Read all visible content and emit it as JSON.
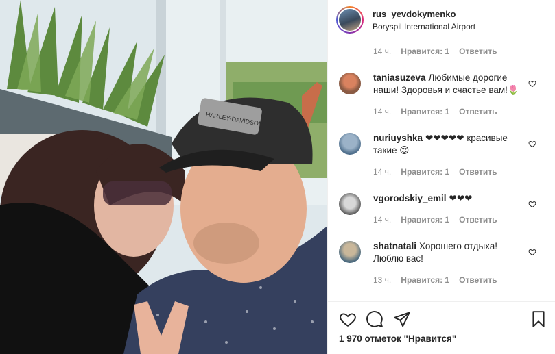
{
  "post": {
    "username": "rus_yevdokymenko",
    "location": "Boryspil International Airport",
    "photo_cap_text": "HARLEY-DAVIDSON"
  },
  "first_meta": {
    "time": "14 ч.",
    "likes": "Нравится: 1",
    "reply": "Ответить"
  },
  "comments": [
    {
      "user": "taniasuzeva",
      "text": "Любимые дорогие наши! Здоровья и счастье вам!🌷",
      "time": "14 ч.",
      "likes": "Нравится: 1",
      "reply": "Ответить"
    },
    {
      "user": "nuriuyshka",
      "text": "❤❤❤❤❤ красивые такие 😍",
      "time": "14 ч.",
      "likes": "Нравится: 1",
      "reply": "Ответить"
    },
    {
      "user": "vgorodskiy_emil",
      "text": "❤❤❤",
      "time": "14 ч.",
      "likes": "Нравится: 1",
      "reply": "Ответить"
    },
    {
      "user": "shatnatali",
      "text": "Хорошего отдыха! Люблю вас!",
      "time": "13 ч.",
      "likes": "Нравится: 1",
      "reply": "Ответить"
    }
  ],
  "actions": {
    "like_icon": "heart-icon",
    "comment_icon": "comment-icon",
    "share_icon": "share-icon",
    "save_icon": "bookmark-icon",
    "likes_count": "1 970 отметок \"Нравится\""
  },
  "colors": {
    "text": "#262626",
    "muted": "#8e8e8e",
    "border": "#efefef"
  }
}
